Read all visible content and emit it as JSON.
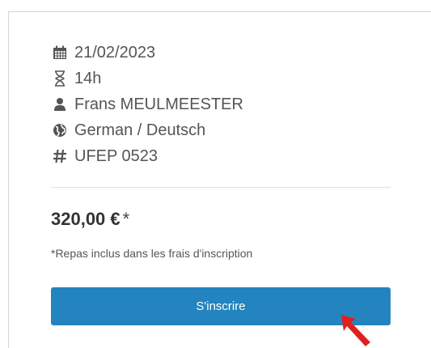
{
  "course": {
    "date": "21/02/2023",
    "duration": "14h",
    "trainer": "Frans MEULMEESTER",
    "language": "German / Deutsch",
    "code": "UFEP 0523"
  },
  "price": {
    "amount": "320,00 €",
    "asterisk": "*"
  },
  "note": "*Repas inclus dans les frais d'inscription",
  "cta": {
    "label": "S'inscrire",
    "color": "#2384bf"
  },
  "icons": {
    "date": "calendar-icon",
    "duration": "hourglass-icon",
    "trainer": "user-icon",
    "language": "globe-icon",
    "code": "hash-icon"
  },
  "cursor_color": "#e02020"
}
